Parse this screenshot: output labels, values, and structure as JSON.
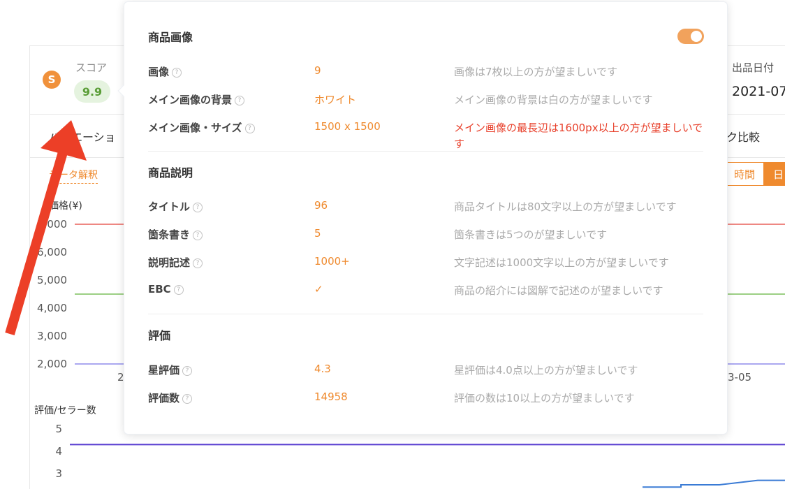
{
  "card": {
    "score_label": "スコア",
    "score_value": "9.9",
    "score_logo": "S",
    "date_label": "出品日付",
    "date_value": "2021-07",
    "tab_left": "バリエーショ",
    "tab_right": "ク比較",
    "data_interp": "データ解釈",
    "seg_time": "時間",
    "seg_day": "日"
  },
  "chart_data": [
    {
      "type": "line",
      "ylabel": "価格(¥)",
      "y_ticks": [
        "7,000",
        "6,000",
        "5,000",
        "4,000",
        "3,000",
        "2,000"
      ],
      "x_ticks": [
        "2",
        "3-05"
      ],
      "series": [
        {
          "values": [
            7000,
            7000
          ],
          "color": "#e8615a"
        },
        {
          "values": [
            4500,
            4500
          ],
          "color": "#7cbf5c"
        },
        {
          "values": [
            2000,
            2000
          ],
          "color": "#8f8cec"
        }
      ],
      "ylim": [
        2000,
        7000
      ]
    },
    {
      "type": "line",
      "ylabel": "評価/セラー数",
      "y_ticks": [
        "5",
        "4",
        "3"
      ],
      "series": [
        {
          "values": [
            4.3,
            4.3
          ],
          "color": "#5a3fd0"
        },
        {
          "values": [
            2.4,
            2.4,
            2.5,
            2.5,
            2.7,
            2.7
          ],
          "color": "#3a7bd5"
        }
      ],
      "ylim": [
        2.3,
        5
      ]
    }
  ],
  "popover": {
    "toggle_on": true,
    "accent_color": "#ef8a2e",
    "warn_color": "#e8412c",
    "help_glyph": "?",
    "sections": [
      {
        "title": "商品画像",
        "rows": [
          {
            "label": "画像",
            "value": "9",
            "desc": "画像は7枚以上の方が望ましいです",
            "warn": false
          },
          {
            "label": "メイン画像の背景",
            "value": "ホワイト",
            "desc": "メイン画像の背景は白の方が望ましいです",
            "warn": false
          },
          {
            "label": "メイン画像・サイズ",
            "value": "1500 x 1500",
            "desc": "メイン画像の最長辺は1600px以上の方が望ましいです",
            "warn": true
          }
        ]
      },
      {
        "title": "商品説明",
        "rows": [
          {
            "label": "タイトル",
            "value": "96",
            "desc": "商品タイトルは80文字以上の方が望ましいです",
            "warn": false
          },
          {
            "label": "箇条書き",
            "value": "5",
            "desc": "箇条書きは5つのが望ましいです",
            "warn": false
          },
          {
            "label": "説明記述",
            "value": "1000+",
            "desc": "文字記述は1000文字以上の方が望ましいです",
            "warn": false
          },
          {
            "label": "EBC",
            "value": "✓",
            "desc": "商品の紹介には図解で記述のが望ましいです",
            "warn": false
          }
        ]
      },
      {
        "title": "評価",
        "rows": [
          {
            "label": "星評価",
            "value": "4.3",
            "desc": "星評価は4.0点以上の方が望ましいです",
            "warn": false
          },
          {
            "label": "評価数",
            "value": "14958",
            "desc": "評価の数は10以上の方が望ましいです",
            "warn": false
          }
        ]
      }
    ]
  }
}
